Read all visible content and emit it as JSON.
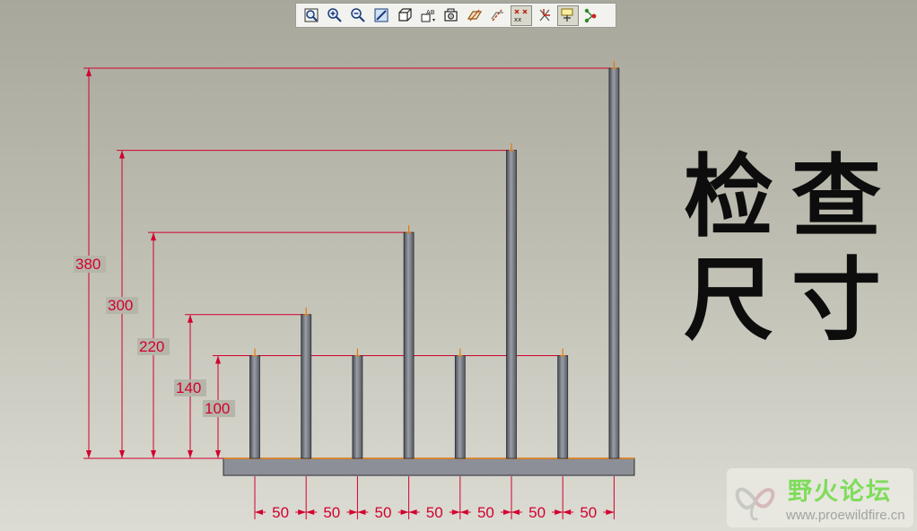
{
  "toolbar": {
    "buttons": [
      {
        "icon": "zoom-window-icon",
        "active": false
      },
      {
        "icon": "zoom-in-icon",
        "active": false
      },
      {
        "icon": "zoom-out-icon",
        "active": false
      },
      {
        "icon": "repaint-icon",
        "active": false
      },
      {
        "icon": "view-orientation-icon",
        "active": false
      },
      {
        "icon": "named-views-icon",
        "active": false
      },
      {
        "icon": "layers-icon",
        "active": false
      },
      {
        "icon": "datum-planes-icon",
        "active": false
      },
      {
        "icon": "datum-axes-icon",
        "active": false
      },
      {
        "icon": "datum-points-icon",
        "active": true
      },
      {
        "icon": "coordinate-systems-icon",
        "active": false
      },
      {
        "icon": "annotation-display-icon",
        "active": true
      },
      {
        "icon": "spin-center-icon",
        "active": false
      }
    ]
  },
  "drawing": {
    "vertical_dims": [
      "380",
      "300",
      "220",
      "140",
      "100"
    ],
    "horizontal_dims": [
      "50",
      "50",
      "50",
      "50",
      "50",
      "50",
      "50"
    ],
    "post_heights": [
      100,
      140,
      100,
      220,
      100,
      300,
      100,
      380
    ],
    "dimension_color": "#d2002e",
    "post_color": "#6e7179",
    "base_color": "#8c8f97",
    "tip_color": "#e07a10"
  },
  "title": {
    "line1": [
      "检",
      "查"
    ],
    "line2": [
      "尺",
      "寸"
    ]
  },
  "watermark": {
    "name": "野火论坛",
    "url": "www.proewildfire.cn"
  }
}
